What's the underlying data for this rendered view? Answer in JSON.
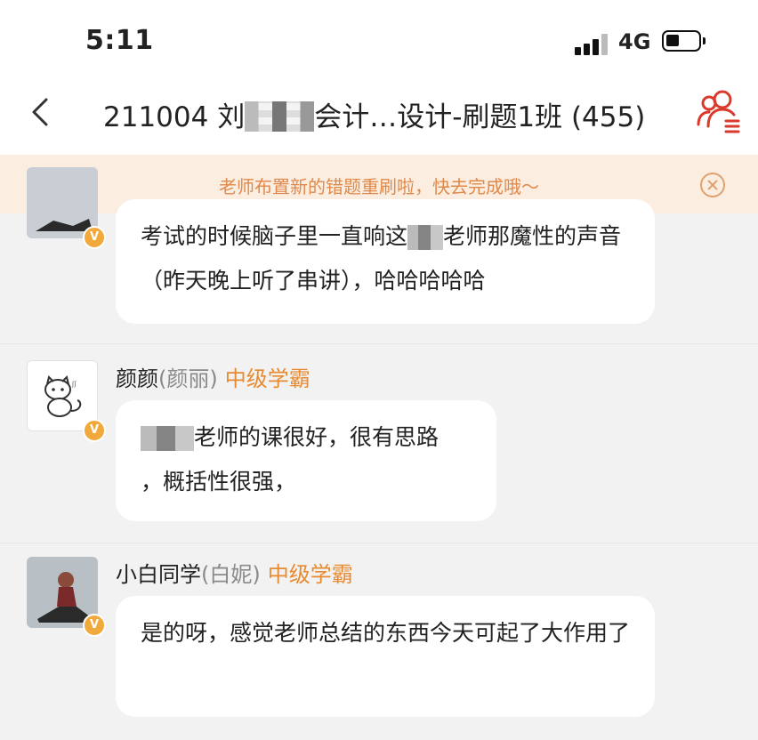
{
  "status_bar": {
    "time": "5:11",
    "network": "4G"
  },
  "nav": {
    "title_start": "211004 刘",
    "title_end": "会计…设计-刷题1班 (455)"
  },
  "notice": {
    "text": "老师布置新的错题重刷啦，快去完成哦～"
  },
  "messages": [
    {
      "text_part1": "考试的时候脑子里一直响这",
      "text_part2": "老师那魔性的声音（昨天晚上听了串讲），哈哈哈哈哈",
      "badge": "V"
    },
    {
      "name": "颜颜",
      "nickname": "(颜丽)",
      "level": "中级学霸",
      "text_part1": "老师的课很好，很有思路",
      "text_part2": "，概括性很强，",
      "badge": "V"
    },
    {
      "name": "小白同学",
      "nickname": "(白妮)",
      "level": "中级学霸",
      "text": "是的呀，感觉老师总结的东西今天可起了大作用了",
      "badge": "V"
    }
  ],
  "colors": {
    "accent": "#e88a2f",
    "notice_bg": "#fbeee1",
    "badge": "#f2a93b",
    "members_icon": "#d93a2b"
  },
  "icons": [
    "back-icon",
    "group-members-icon",
    "close-circle-icon",
    "signal-icon",
    "battery-icon"
  ]
}
